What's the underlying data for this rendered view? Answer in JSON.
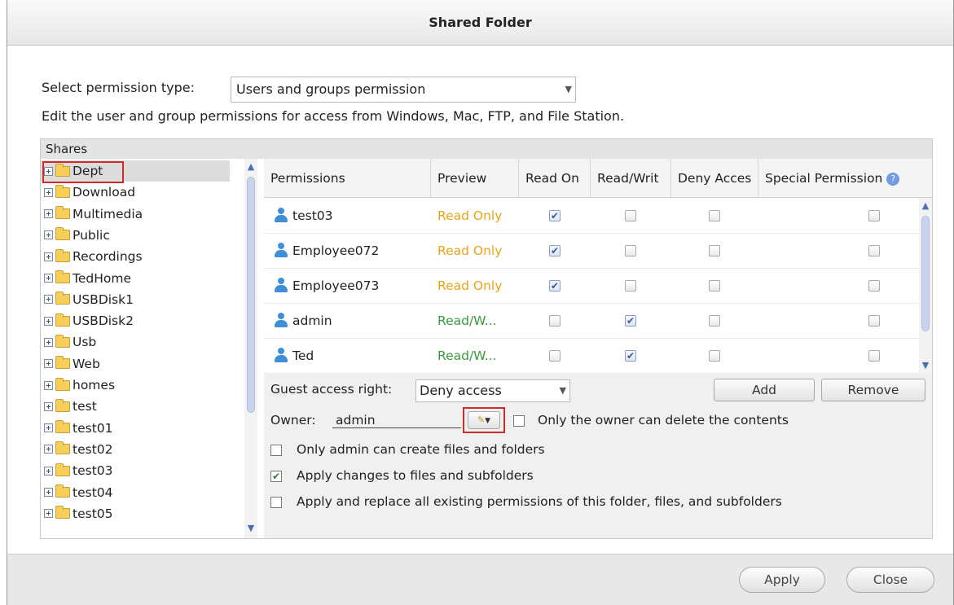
{
  "title": "Shared Folder",
  "permission_type": {
    "label": "Select permission type:",
    "value": "Users and groups permission"
  },
  "description": "Edit the user and group permissions for access from Windows, Mac, FTP, and File Station.",
  "shares": {
    "header": "Shares",
    "items": [
      "Dept",
      "Download",
      "Multimedia",
      "Public",
      "Recordings",
      "TedHome",
      "USBDisk1",
      "USBDisk2",
      "Usb",
      "Web",
      "homes",
      "test",
      "test01",
      "test02",
      "test03",
      "test04",
      "test05"
    ]
  },
  "table": {
    "columns": [
      "Permissions",
      "Preview",
      "Read On",
      "Read/Writ",
      "Deny Acces",
      "Special Permission"
    ],
    "rows": [
      {
        "name": "test03",
        "preview": "Read Only",
        "preview_color": "#e8a317",
        "read_only": true,
        "read_write": false,
        "deny": false,
        "special": false
      },
      {
        "name": "Employee072",
        "preview": "Read Only",
        "preview_color": "#e8a317",
        "read_only": true,
        "read_write": false,
        "deny": false,
        "special": false
      },
      {
        "name": "Employee073",
        "preview": "Read Only",
        "preview_color": "#e8a317",
        "read_only": true,
        "read_write": false,
        "deny": false,
        "special": false
      },
      {
        "name": "admin",
        "preview": "Read/W...",
        "preview_color": "#3a9a3a",
        "read_only": false,
        "read_write": true,
        "deny": false,
        "special": false
      },
      {
        "name": "Ted",
        "preview": "Read/W...",
        "preview_color": "#3a9a3a",
        "read_only": false,
        "read_write": true,
        "deny": false,
        "special": false
      }
    ]
  },
  "guest": {
    "label": "Guest access right:",
    "value": "Deny access"
  },
  "add_label": "Add",
  "remove_label": "Remove",
  "owner": {
    "label": "Owner:",
    "value": "admin",
    "only_owner_delete_label": "Only the owner can delete the contents"
  },
  "options": {
    "only_admin_create": {
      "label": "Only admin can create files and folders",
      "checked": false
    },
    "apply_subfolders": {
      "label": "Apply changes to files and subfolders",
      "checked": true
    },
    "apply_replace": {
      "label": "Apply and replace all existing permissions of this folder, files, and subfolders",
      "checked": false
    }
  },
  "apply_label": "Apply",
  "close_label": "Close"
}
